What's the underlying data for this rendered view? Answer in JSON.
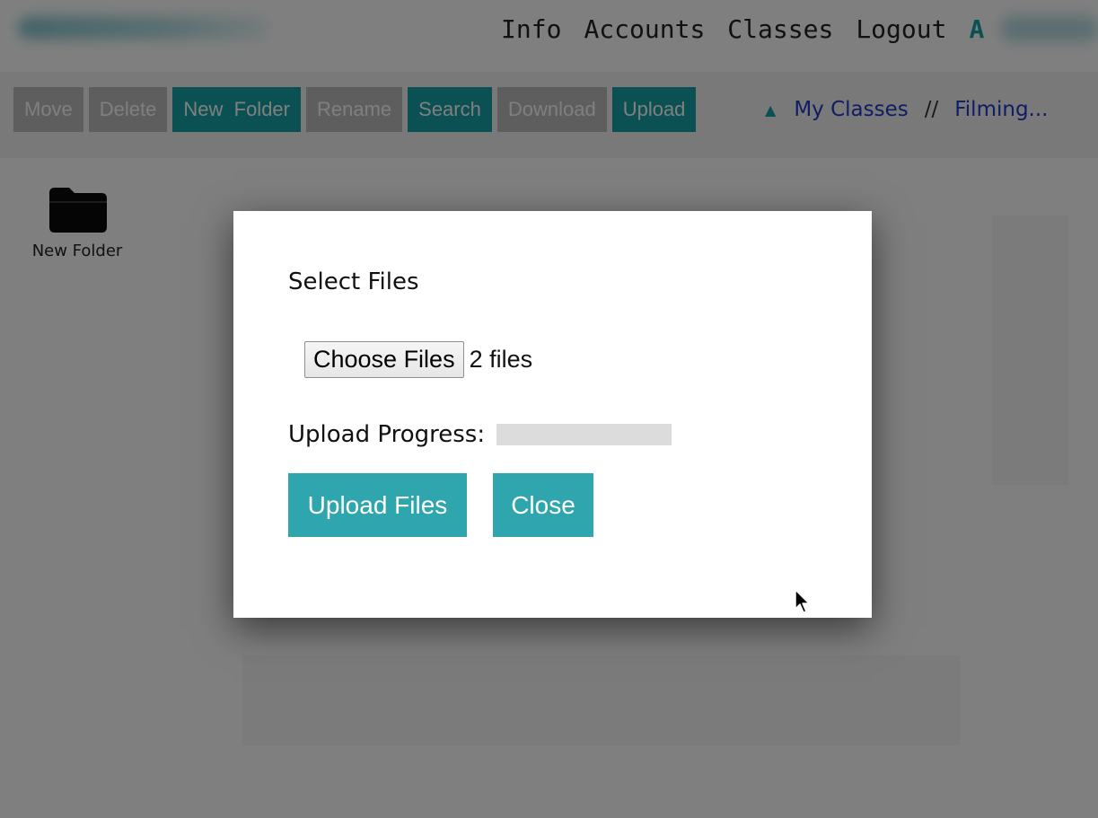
{
  "topnav": {
    "items": [
      "Info",
      "Accounts",
      "Classes",
      "Logout"
    ],
    "user_initial": "A"
  },
  "toolbar": {
    "buttons": [
      {
        "label": "Move",
        "state": "disabled"
      },
      {
        "label": "Delete",
        "state": "disabled"
      },
      {
        "label": "New  Folder",
        "state": "active"
      },
      {
        "label": "Rename",
        "state": "disabled"
      },
      {
        "label": "Search",
        "state": "active"
      },
      {
        "label": "Download",
        "state": "disabled"
      },
      {
        "label": "Upload",
        "state": "active"
      }
    ]
  },
  "breadcrumb": {
    "up_glyph": "▲",
    "root": "My Classes",
    "separator": "//",
    "current": "Filming..."
  },
  "files": [
    {
      "name": "New Folder",
      "icon": "folder-icon"
    }
  ],
  "modal": {
    "title": "Select Files",
    "choose_button": "Choose Files",
    "file_count": "2 files",
    "progress_label": "Upload Progress:",
    "progress_value": 0,
    "upload_button": "Upload Files",
    "close_button": "Close"
  },
  "colors": {
    "accent": "#17a2a6",
    "modal_button": "#2fa5ad",
    "disabled_button": "#bdbdbd",
    "link": "#1c3ac9"
  }
}
